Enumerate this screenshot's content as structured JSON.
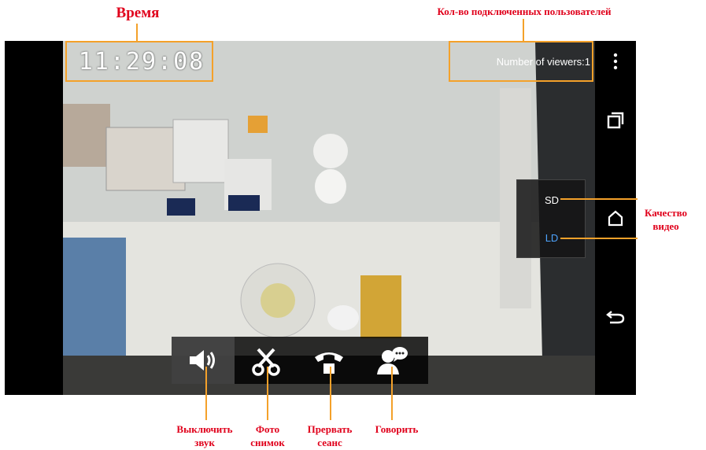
{
  "annotations": {
    "time": "Время",
    "viewers": "Кол-во подключенных пользователей",
    "quality_line1": "Качество",
    "quality_line2": "видео",
    "mute_line1": "Выключить",
    "mute_line2": "звук",
    "photo_line1": "Фото",
    "photo_line2": "снимок",
    "hangup_line1": "Прервать",
    "hangup_line2": "сеанс",
    "talk": "Говорить"
  },
  "overlay": {
    "clock": "11:29:08",
    "viewers": "Number of viewers:1"
  },
  "quality": {
    "options": [
      "SD",
      "LD"
    ],
    "selected": "LD",
    "sd_color": "#ffffff",
    "ld_color": "#4da3ff"
  },
  "toolbar": {
    "buttons": [
      "speaker-icon",
      "scissors-icon",
      "hangup-icon",
      "talk-icon"
    ]
  },
  "navbar": {
    "icons": [
      "overflow-menu-icon",
      "recent-apps-icon",
      "home-icon",
      "back-icon"
    ]
  },
  "colors": {
    "annotation": "#e0001b",
    "highlight": "#f4a12a",
    "screen_bg": "#000000"
  }
}
